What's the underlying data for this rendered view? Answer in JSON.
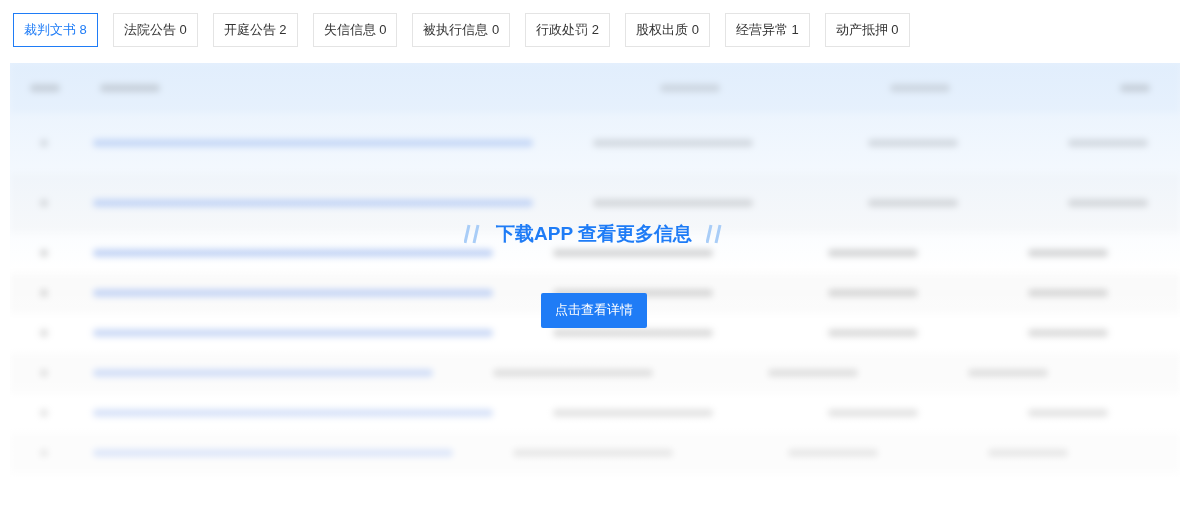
{
  "tabs": [
    {
      "label": "裁判文书 8",
      "selected": true
    },
    {
      "label": "法院公告 0",
      "selected": false
    },
    {
      "label": "开庭公告 2",
      "selected": false
    },
    {
      "label": "失信信息 0",
      "selected": false
    },
    {
      "label": "被执行信息 0",
      "selected": false
    },
    {
      "label": "行政处罚 2",
      "selected": false
    },
    {
      "label": "股权出质 0",
      "selected": false
    },
    {
      "label": "经营异常 1",
      "selected": false
    },
    {
      "label": "动产抵押 0",
      "selected": false
    }
  ],
  "overlay": {
    "title": "下载APP 查看更多信息",
    "button": "点击查看详情"
  }
}
